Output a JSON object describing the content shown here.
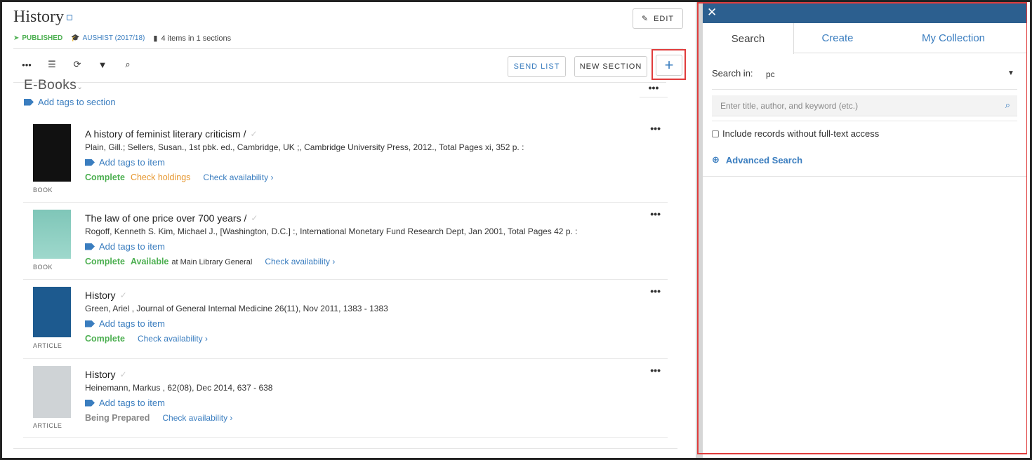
{
  "header": {
    "title": "History",
    "edit_label": "EDIT",
    "published": "PUBLISHED",
    "course": "AUSHIST (2017/18)",
    "items_summary": "4 items in 1 sections"
  },
  "toolbar": {
    "send_list_label": "SEND LIST",
    "new_section_label": "NEW SECTION",
    "add_label": "+"
  },
  "section": {
    "title": "E-Books",
    "add_tags_label": "Add tags to section"
  },
  "items": [
    {
      "title": "A history of feminist literary criticism /",
      "citation": "Plain, Gill.; Sellers, Susan., 1st pbk. ed., Cambridge, UK ;, Cambridge University Press, 2012., Total Pages xi, 352 p. :",
      "tags_label": "Add tags to item",
      "status1": "Complete",
      "status2": "Check holdings",
      "check_label": "Check availability ›",
      "type": "BOOK"
    },
    {
      "title": "The law of one price over 700 years /",
      "citation": "Rogoff, Kenneth S. Kim, Michael J., [Washington, D.C.] :, International Monetary Fund Research Dept, Jan 2001, Total Pages 42 p. :",
      "tags_label": "Add tags to item",
      "status1": "Complete",
      "status2": "Available",
      "location": "at Main Library General",
      "check_label": "Check availability ›",
      "type": "BOOK"
    },
    {
      "title": "History",
      "citation": "Green, Ariel , Journal of General Internal Medicine 26(11), Nov 2011, 1383 - 1383",
      "tags_label": "Add tags to item",
      "status1": "Complete",
      "check_label": "Check availability ›",
      "type": "ARTICLE"
    },
    {
      "title": "History",
      "citation": "Heinemann, Markus , 62(08), Dec 2014, 637 - 638",
      "tags_label": "Add tags to item",
      "status1": "Being Prepared",
      "check_label": "Check availability ›",
      "type": "ARTICLE"
    }
  ],
  "panel": {
    "tabs": [
      "Search",
      "Create",
      "My Collection"
    ],
    "search_in_label": "Search in:",
    "search_in_value": "pc",
    "search_placeholder": "Enter title, author, and keyword (etc.)",
    "include_label": "Include records without full-text access",
    "advanced_label": "Advanced Search"
  },
  "colors": {
    "accent": "#3a7dbf",
    "header_bar": "#2c5f8f",
    "success": "#4caf50",
    "warning": "#e6962e",
    "highlight_outline": "#e03c3c"
  },
  "icons": [
    "pencil-icon",
    "paper-plane-icon",
    "graduation-cap-icon",
    "book-icon",
    "ellipsis-icon",
    "list-icon",
    "refresh-icon",
    "filter-icon",
    "search-icon",
    "tag-icon",
    "checkmark-icon",
    "close-icon",
    "zoom-in-icon"
  ]
}
